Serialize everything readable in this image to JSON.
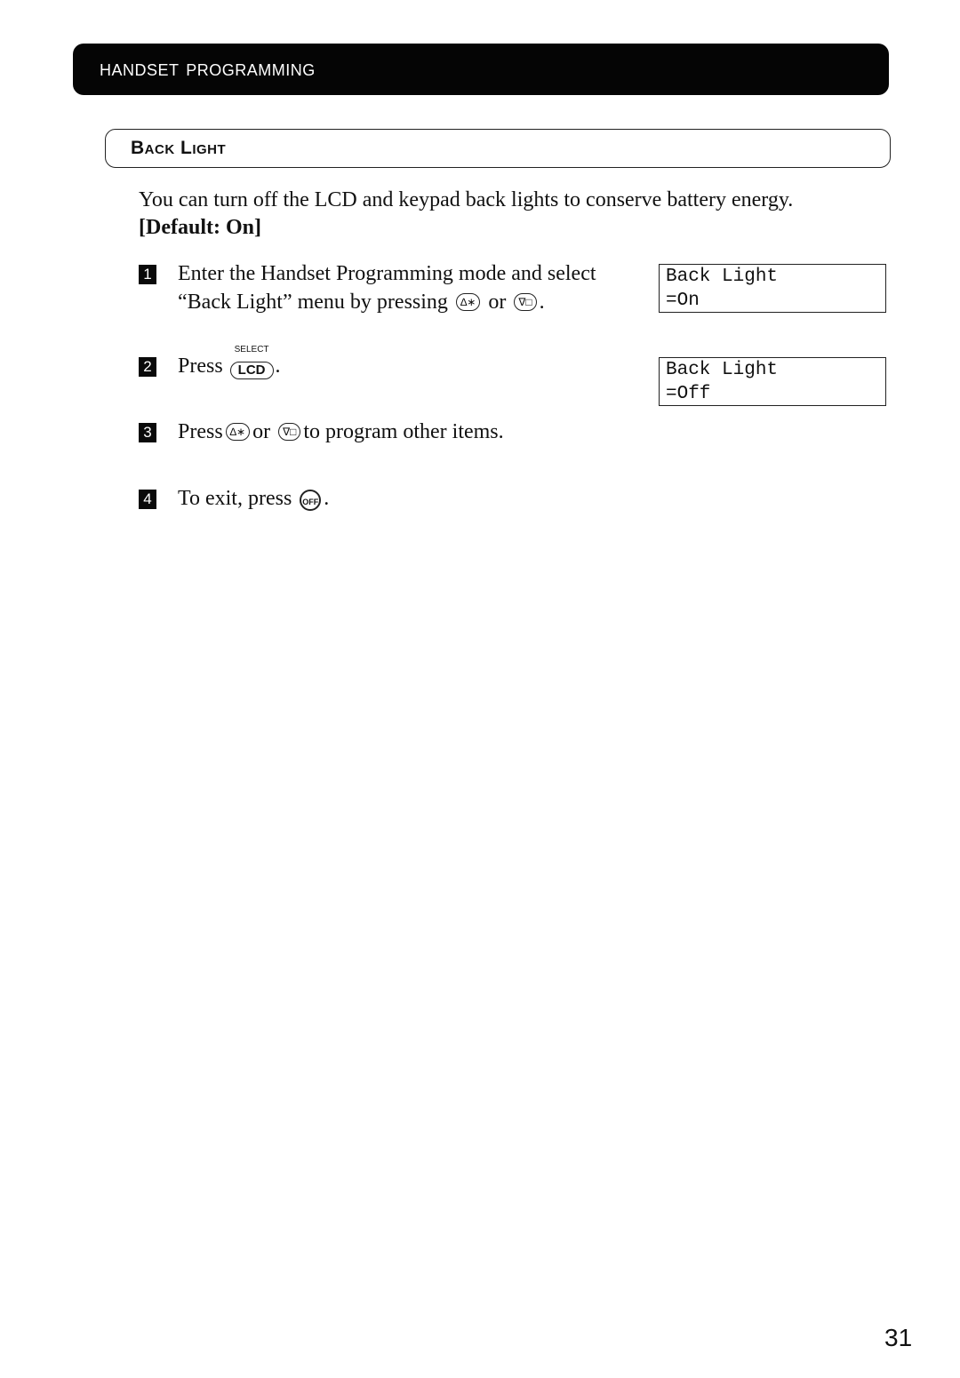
{
  "header": {
    "title": "Handset Programming"
  },
  "section": {
    "title": "Back Light"
  },
  "intro": {
    "text": "You can turn off the LCD and keypad back lights to conserve battery energy.",
    "default": "[Default: On]"
  },
  "steps": [
    {
      "number": "1",
      "line1": "Enter the Handset Programming mode and select",
      "line2_a": "“Back Light” menu by pressing",
      "key_a": "∆∗",
      "or": "or",
      "key_b": "∇□",
      "end": "."
    },
    {
      "number": "2",
      "prefix": "Press",
      "key_top": "SELECT",
      "key_label": "LCD",
      "end": "."
    },
    {
      "number": "3",
      "prefix": "Press",
      "key_a": "∆∗",
      "or": "or",
      "key_b": "∇□",
      "suffix": "to program other items."
    },
    {
      "number": "4",
      "prefix": "To exit, press",
      "key_label": "OFF",
      "end": "."
    }
  ],
  "lcd_displays": [
    {
      "line1": "Back Light",
      "line2": "=On"
    },
    {
      "line1": "Back Light",
      "line2": "=Off"
    }
  ],
  "page_number": "31"
}
